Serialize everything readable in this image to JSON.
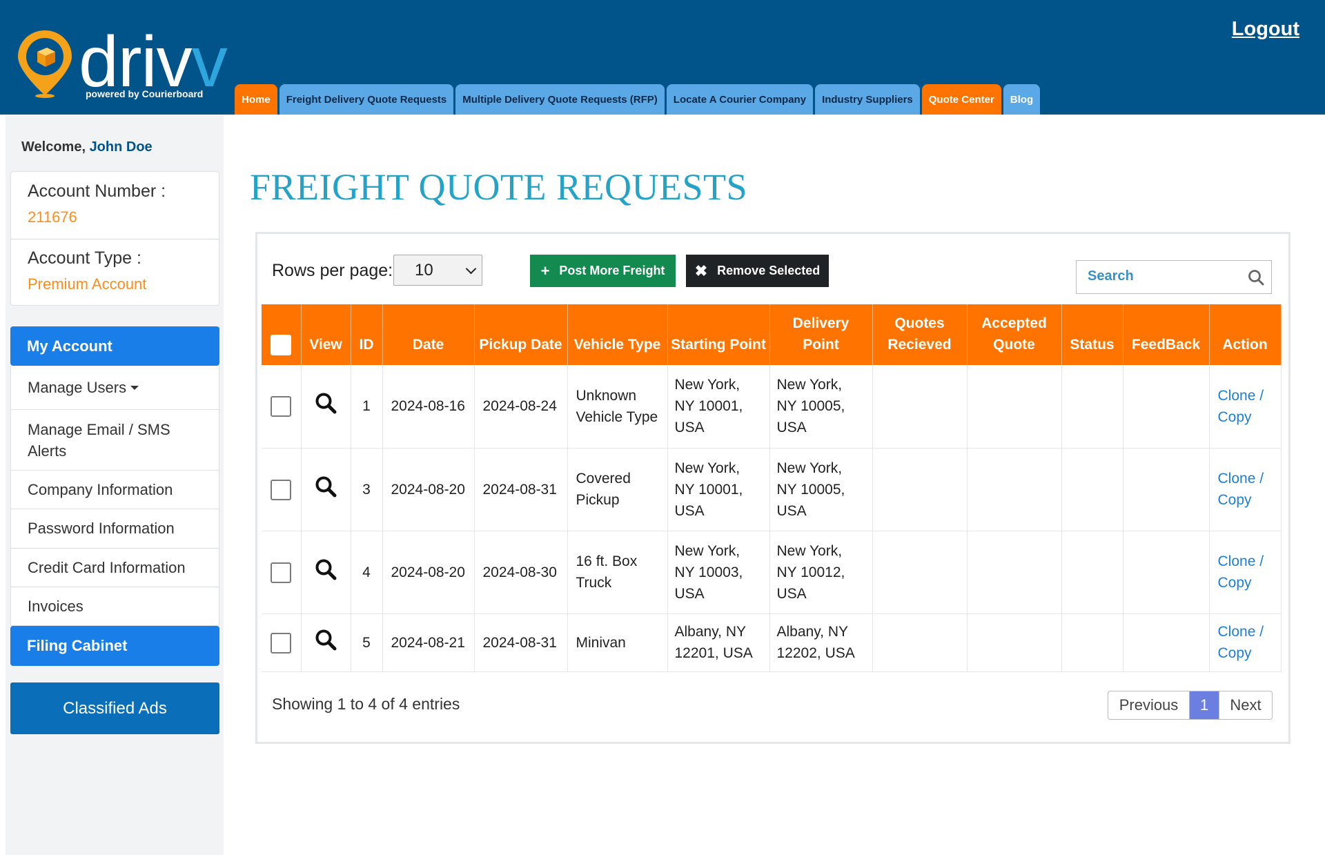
{
  "header": {
    "logo_text_a": "driv",
    "logo_text_b": "v",
    "logo_tagline": "powered by Courierboard",
    "logout": "Logout",
    "nav": [
      {
        "label": "Home",
        "style": "orange"
      },
      {
        "label": "Freight Delivery Quote Requests",
        "style": "blue"
      },
      {
        "label": "Multiple Delivery Quote Requests (RFP)",
        "style": "blue"
      },
      {
        "label": "Locate A Courier Company",
        "style": "blue"
      },
      {
        "label": "Industry Suppliers",
        "style": "blue"
      },
      {
        "label": "Quote Center",
        "style": "orange"
      },
      {
        "label": "Blog",
        "style": "blue"
      }
    ]
  },
  "sidebar": {
    "welcome_prefix": "Welcome,",
    "user_name": "John Doe",
    "account_number_label": "Account Number :",
    "account_number": "211676",
    "account_type_label": "Account Type :",
    "account_type": "Premium Account",
    "menu": [
      {
        "label": "My Account",
        "active": true
      },
      {
        "label": "Manage Users",
        "dropdown": true
      },
      {
        "label": "Manage Email / SMS Alerts"
      },
      {
        "label": "Company Information"
      },
      {
        "label": "Password Information"
      },
      {
        "label": "Credit Card Information"
      },
      {
        "label": "Invoices"
      },
      {
        "label": "Filing Cabinet",
        "active": true
      }
    ],
    "classified_ads": "Classified Ads"
  },
  "main": {
    "title": "FREIGHT QUOTE REQUESTS",
    "rows_per_page_label": "Rows per page:",
    "rows_per_page_value": "10",
    "post_button": "Post More Freight",
    "remove_button": "Remove Selected",
    "search_placeholder": "Search",
    "table": {
      "headers": [
        "View",
        "ID",
        "Date",
        "Pickup Date",
        "Vehicle Type",
        "Starting Point",
        "Delivery Point",
        "Quotes Recieved",
        "Accepted Quote",
        "Status",
        "FeedBack",
        "Action"
      ],
      "rows": [
        {
          "id": "1",
          "date": "2024-08-16",
          "pickup": "2024-08-24",
          "vehicle": "Unknown Vehicle Type",
          "start": "New York, NY 10001, USA",
          "delivery": "New York, NY 10005, USA",
          "quotes": "",
          "accepted": "",
          "status": "",
          "feedback": "",
          "action": "Clone / Copy"
        },
        {
          "id": "3",
          "date": "2024-08-20",
          "pickup": "2024-08-31",
          "vehicle": "Covered Pickup",
          "start": "New York, NY 10001, USA",
          "delivery": "New York, NY 10005, USA",
          "quotes": "",
          "accepted": "",
          "status": "",
          "feedback": "",
          "action": "Clone / Copy"
        },
        {
          "id": "4",
          "date": "2024-08-20",
          "pickup": "2024-08-30",
          "vehicle": "16 ft. Box Truck",
          "start": "New York, NY 10003, USA",
          "delivery": "New York, NY 10012, USA",
          "quotes": "",
          "accepted": "",
          "status": "",
          "feedback": "",
          "action": "Clone / Copy"
        },
        {
          "id": "5",
          "date": "2024-08-21",
          "pickup": "2024-08-31",
          "vehicle": "Minivan",
          "start": "Albany, NY 12201, USA",
          "delivery": "Albany, NY 12202, USA",
          "quotes": "",
          "accepted": "",
          "status": "",
          "feedback": "",
          "action": "Clone / Copy"
        }
      ]
    },
    "showing": "Showing 1 to 4 of 4 entries",
    "pager": {
      "prev": "Previous",
      "current": "1",
      "next": "Next"
    }
  },
  "colors": {
    "header_bg": "#00548a",
    "accent_orange": "#ff7400",
    "title_teal": "#25a3c7",
    "active_blue": "#1a7ee8",
    "link_blue": "#1b7fd6"
  }
}
